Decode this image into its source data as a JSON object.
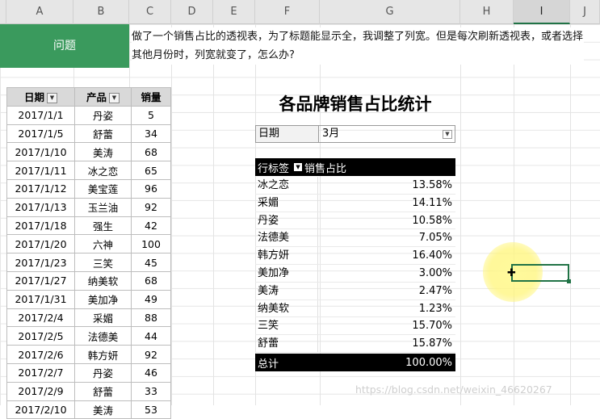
{
  "columns": [
    "A",
    "B",
    "C",
    "D",
    "E",
    "F",
    "G",
    "H",
    "I",
    "J"
  ],
  "selected_column": "I",
  "question": {
    "label": "问题",
    "text": "做了一个销售占比的透视表，为了标题能显示全，我调整了列宽。但是每次刷新透视表，或者选择其他月份时，列宽就变了，怎么办?"
  },
  "source_table": {
    "headers": [
      "日期",
      "产品",
      "销量"
    ],
    "rows": [
      [
        "2017/1/1",
        "丹姿",
        "5"
      ],
      [
        "2017/1/5",
        "舒蕾",
        "34"
      ],
      [
        "2017/1/10",
        "美涛",
        "68"
      ],
      [
        "2017/1/11",
        "冰之恋",
        "65"
      ],
      [
        "2017/1/12",
        "美宝莲",
        "96"
      ],
      [
        "2017/1/13",
        "玉兰油",
        "92"
      ],
      [
        "2017/1/18",
        "强生",
        "42"
      ],
      [
        "2017/1/20",
        "六神",
        "100"
      ],
      [
        "2017/1/23",
        "三笑",
        "45"
      ],
      [
        "2017/1/27",
        "纳美软",
        "68"
      ],
      [
        "2017/1/31",
        "美加净",
        "49"
      ],
      [
        "2017/2/4",
        "采媚",
        "88"
      ],
      [
        "2017/2/5",
        "法德美",
        "44"
      ],
      [
        "2017/2/6",
        "韩方妍",
        "92"
      ],
      [
        "2017/2/7",
        "丹姿",
        "46"
      ],
      [
        "2017/2/9",
        "舒蕾",
        "33"
      ],
      [
        "2017/2/10",
        "美涛",
        "53"
      ]
    ]
  },
  "pivot": {
    "title": "各品牌销售占比统计",
    "filter_label": "日期",
    "filter_value": "3月",
    "row_label": "行标签",
    "value_label": "销售占比",
    "rows": [
      [
        "冰之恋",
        "13.58%"
      ],
      [
        "采媚",
        "14.11%"
      ],
      [
        "丹姿",
        "10.58%"
      ],
      [
        "法德美",
        "7.05%"
      ],
      [
        "韩方妍",
        "16.40%"
      ],
      [
        "美加净",
        "3.00%"
      ],
      [
        "美涛",
        "2.47%"
      ],
      [
        "纳美软",
        "1.23%"
      ],
      [
        "三笑",
        "15.70%"
      ],
      [
        "舒蕾",
        "15.87%"
      ]
    ],
    "total_label": "总计",
    "total_value": "100.00%"
  },
  "watermark": "https://blog.csdn.net/weixin_46620267",
  "icons": {
    "filter": "filter-dropdown-icon",
    "cursor": "cell-cursor-icon"
  }
}
